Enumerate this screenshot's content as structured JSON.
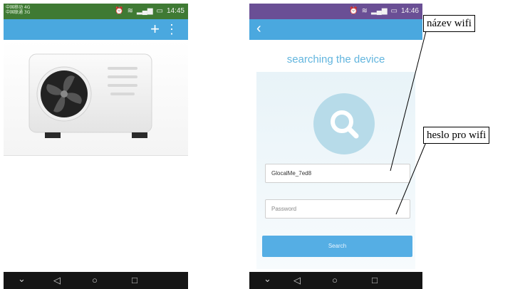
{
  "left_phone": {
    "status": {
      "carrier_line1": "中国移动 4G",
      "carrier_line2": "中国联通 3G",
      "time": "14:45"
    },
    "appbar": {
      "add_icon": "+",
      "more_icon": "⋮"
    },
    "device_image": "air-conditioner-outdoor-unit",
    "nav": {
      "back": "◁",
      "home": "○",
      "recent": "□",
      "down": "⌄"
    }
  },
  "right_phone": {
    "status": {
      "time": "14:46"
    },
    "appbar": {
      "back_icon": "‹"
    },
    "title": "searching the device",
    "search_icon": "magnifier",
    "wifi_name": "GlocalMe_7ed8",
    "password_placeholder": "Password",
    "search_button": "Search",
    "nav": {
      "back": "◁",
      "home": "○",
      "recent": "□",
      "down": "⌄"
    }
  },
  "annotations": {
    "wifi_name_label": "název wifi",
    "wifi_password_label": "heslo pro wifi"
  },
  "colors": {
    "status_bar": "#3f7a34",
    "app_bar": "#4aa8df",
    "accent_text": "#62b5de",
    "button": "#55aee4"
  }
}
